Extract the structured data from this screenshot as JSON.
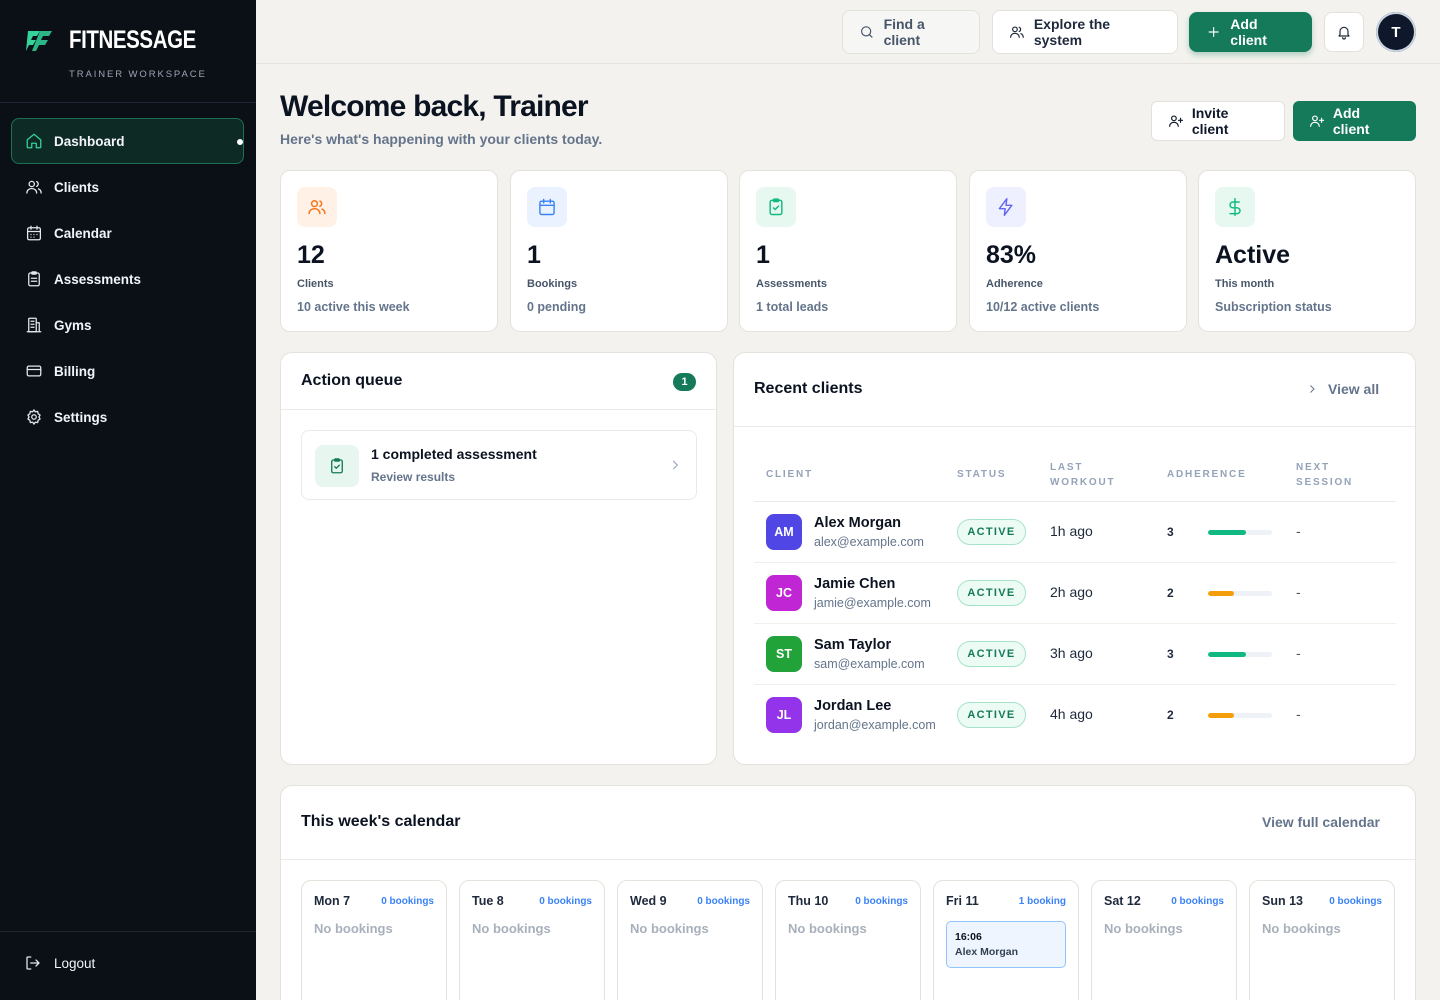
{
  "brand": {
    "name": "FITNESSAGE",
    "subtitle": "TRAINER WORKSPACE"
  },
  "sidebar": {
    "items": [
      {
        "label": "Dashboard",
        "icon": "home-icon",
        "active": true
      },
      {
        "label": "Clients",
        "icon": "users-icon"
      },
      {
        "label": "Calendar",
        "icon": "calendar-icon"
      },
      {
        "label": "Assessments",
        "icon": "clipboard-icon"
      },
      {
        "label": "Gyms",
        "icon": "building-icon"
      },
      {
        "label": "Billing",
        "icon": "credit-card-icon"
      },
      {
        "label": "Settings",
        "icon": "gear-icon"
      }
    ],
    "logout_label": "Logout"
  },
  "topbar": {
    "find_label": "Find a client",
    "explore_label": "Explore the system",
    "add_label": "Add client",
    "avatar_initial": "T"
  },
  "header": {
    "title": "Welcome back, Trainer",
    "subtitle": "Here's what's happening with your clients today.",
    "invite_label": "Invite client",
    "add_label": "Add client"
  },
  "stats": [
    {
      "value": "12",
      "label": "Clients",
      "note": "10 active this week",
      "icon": "users-icon",
      "color": "#f97316",
      "bg": "#fff1e6"
    },
    {
      "value": "1",
      "label": "Bookings",
      "note": "0 pending",
      "icon": "calendar-icon",
      "color": "#3b82f6",
      "bg": "#eaf2ff"
    },
    {
      "value": "1",
      "label": "Assessments",
      "note": "1 total leads",
      "icon": "clipboard-check-icon",
      "color": "#10b981",
      "bg": "#e6f8f0"
    },
    {
      "value": "83%",
      "label": "Adherence",
      "note": "10/12 active clients",
      "icon": "bolt-icon",
      "color": "#6366f1",
      "bg": "#eef0ff"
    },
    {
      "value": "Active",
      "label": "This month",
      "note": "Subscription status",
      "icon": "dollar-icon",
      "color": "#10b981",
      "bg": "#e6f8f0"
    }
  ],
  "action_queue": {
    "title": "Action queue",
    "count": "1",
    "items": [
      {
        "title": "1 completed assessment",
        "subtitle": "Review results"
      }
    ]
  },
  "recent_clients": {
    "title": "Recent clients",
    "view_all": "View all",
    "columns": [
      "CLIENT",
      "STATUS",
      "LAST WORKOUT",
      "ADHERENCE",
      "NEXT SESSION"
    ],
    "rows": [
      {
        "initials": "AM",
        "name": "Alex Morgan",
        "email": "alex@example.com",
        "status": "ACTIVE",
        "last": "1h ago",
        "adherence": "3",
        "fill": 0.6,
        "bar_color": "#10b981",
        "next": "-",
        "avatar_color": "#4f46e5"
      },
      {
        "initials": "JC",
        "name": "Jamie Chen",
        "email": "jamie@example.com",
        "status": "ACTIVE",
        "last": "2h ago",
        "adherence": "2",
        "fill": 0.4,
        "bar_color": "#f59e0b",
        "next": "-",
        "avatar_color": "#c026d3"
      },
      {
        "initials": "ST",
        "name": "Sam Taylor",
        "email": "sam@example.com",
        "status": "ACTIVE",
        "last": "3h ago",
        "adherence": "3",
        "fill": 0.6,
        "bar_color": "#10b981",
        "next": "-",
        "avatar_color": "#22a33a"
      },
      {
        "initials": "JL",
        "name": "Jordan Lee",
        "email": "jordan@example.com",
        "status": "ACTIVE",
        "last": "4h ago",
        "adherence": "2",
        "fill": 0.4,
        "bar_color": "#f59e0b",
        "next": "-",
        "avatar_color": "#9333ea"
      }
    ]
  },
  "calendar": {
    "title": "This week's calendar",
    "link": "View full calendar",
    "days": [
      {
        "name": "Mon 7",
        "count": "0 bookings",
        "empty": "No bookings"
      },
      {
        "name": "Tue 8",
        "count": "0 bookings",
        "empty": "No bookings"
      },
      {
        "name": "Wed 9",
        "count": "0 bookings",
        "empty": "No bookings"
      },
      {
        "name": "Thu 10",
        "count": "0 bookings",
        "empty": "No bookings"
      },
      {
        "name": "Fri 11",
        "count": "1 booking",
        "booking_time": "16:06",
        "booking_name": "Alex Morgan"
      },
      {
        "name": "Sat 12",
        "count": "0 bookings",
        "empty": "No bookings"
      },
      {
        "name": "Sun 13",
        "count": "0 bookings",
        "empty": "No bookings"
      }
    ]
  }
}
